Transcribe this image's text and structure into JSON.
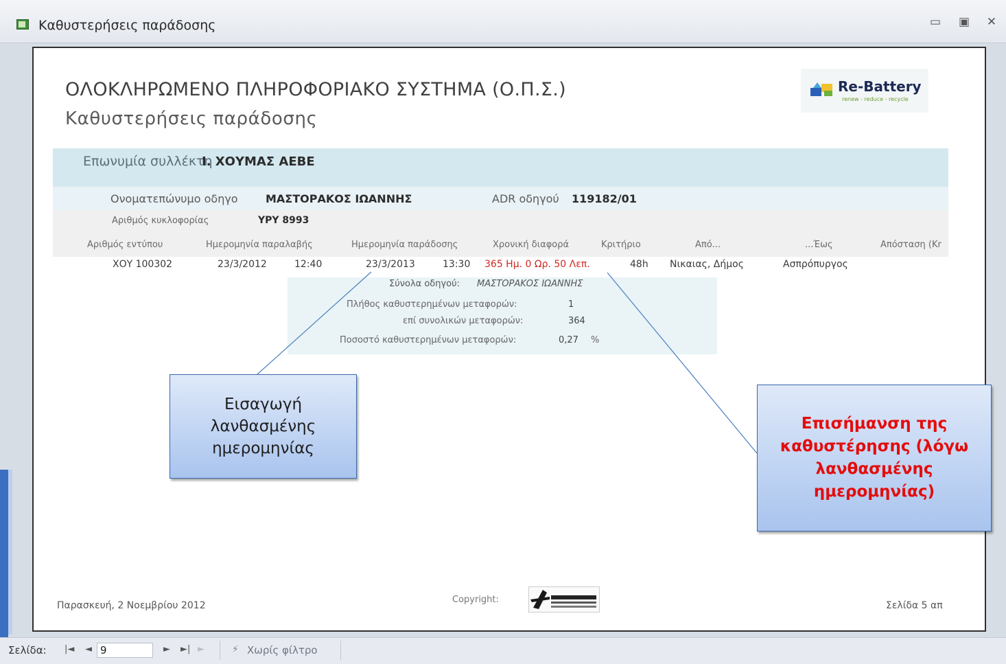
{
  "window": {
    "title": "Καθυστερήσεις παράδοσης",
    "controls": [
      "minimize-icon",
      "maximize-icon",
      "close-icon"
    ]
  },
  "report": {
    "title": "ΟΛΟΚΛΗΡΩΜΕΝΟ ΠΛΗΡΟΦΟΡΙΑΚΟ ΣΥΣΤΗΜΑ (Ο.Π.Σ.)",
    "subtitle": "Καθυστερήσεις παράδοσης",
    "logo_text": "Re-Battery",
    "logo_tagline": "renew - reduce - recycle",
    "collector_label": "Επωνυμία συλλέκτη",
    "collector_value": "Ι. ΧΟΥΜΑΣ ΑΕΒΕ",
    "driver_label": "Ονοματεπώνυμο οδηγο",
    "driver_value": "ΜΑΣΤΟΡΑΚΟΣ ΙΩΑΝΝΗΣ",
    "adr_label": "ADR οδηγού",
    "adr_value": "119182/01",
    "plate_label": "Αριθμός κυκλοφορίας",
    "plate_value": "ΥΡΥ 8993",
    "columns": [
      "Αριθμός εντύπου",
      "Ημερομηνία παραλαβής",
      "Ημερομηνία παράδοσης",
      "Χρονική διαφορά",
      "Κριτήριο",
      "Από...",
      "...Έως",
      "Απόσταση (Kr"
    ],
    "row": {
      "form_no": "ΧΟΥ 100302",
      "pickup_date": "23/3/2012",
      "pickup_time": "12:40",
      "delivery_date": "23/3/2013",
      "delivery_time": "13:30",
      "time_diff": "365 Ημ. 0 Ωρ. 50 Λεπ.",
      "criterion": "48h",
      "from": "Νικαιας, Δήμος",
      "to": "Ασπρόπυργος"
    },
    "summary": {
      "title": "Σύνολα οδηγού:",
      "name": "ΜΑΣΤΟΡΑΚΟΣ ΙΩΑΝΝΗΣ",
      "late_label": "Πλήθος καθυστερημένων μεταφορών:",
      "late_value": "1",
      "total_label": "επί συνολικών μεταφορών:",
      "total_value": "364",
      "pct_label": "Ποσοστό καθυστερημένων μεταφορών:",
      "pct_value": "0,27",
      "pct_unit": "%"
    },
    "footer": {
      "date": "Παρασκευή, 2 Νοεμβρίου 2012",
      "copyright": "Copyright:",
      "page": "Σελίδα 5 απ"
    }
  },
  "callouts": {
    "left": "Εισαγωγή λανθασμένης ημερομηνίας",
    "right": "Επισήμανση της καθυστέρησης (λόγω λανθασμένης ημερομηνίας)"
  },
  "statusbar": {
    "page_label": "Σελίδα:",
    "first": "◄",
    "prev": "◄",
    "page_value": "9",
    "next": "►",
    "last": "►",
    "new": "►",
    "filter": "Χωρίς φίλτρο"
  }
}
